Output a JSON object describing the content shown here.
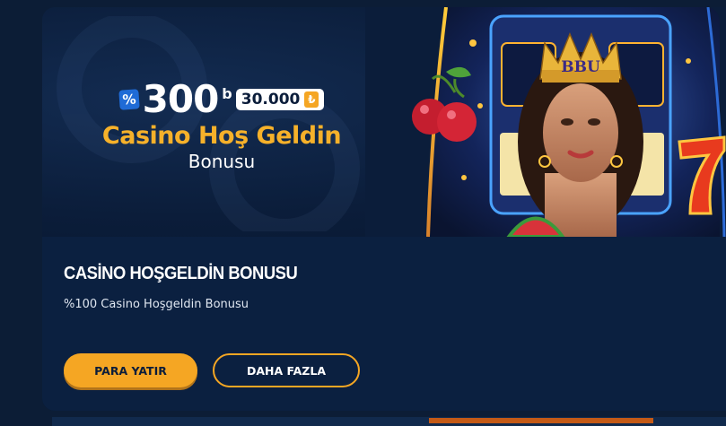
{
  "banner": {
    "percent_symbol": "%",
    "big_number": "300",
    "b_mark": "b",
    "amount": "30.000",
    "currency_symbol": "₺",
    "promo_title": "Casino Hoş Geldin",
    "promo_subtitle": "Bonusu",
    "crown_text": "BBU"
  },
  "bonus": {
    "title": "CASİNO HOŞGELDİN BONUSU",
    "description": "%100 Casino Hoşgeldin Bonusu",
    "primary_button": "PARA YATIR",
    "secondary_button": "DAHA FAZLA"
  },
  "colors": {
    "accent": "#f5a623",
    "background": "#0a1c37",
    "card_body": "#0b2040",
    "badge_blue": "#1f6bd6"
  }
}
